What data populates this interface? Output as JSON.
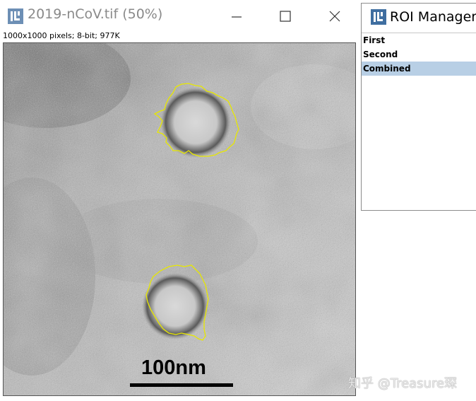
{
  "image_window": {
    "title": "2019-nCoV.tif (50%)",
    "info": "1000x1000 pixels; 8-bit; 977K",
    "icons": {
      "app": "imagej-icon",
      "minimize": "minimize-icon",
      "maximize": "maximize-icon",
      "close": "close-icon"
    },
    "scale_bar_label": "100nm",
    "roi_outline_color": "#e8e800"
  },
  "roi_manager": {
    "title": "ROI Manager",
    "items": [
      {
        "label": "First",
        "selected": false
      },
      {
        "label": "Second",
        "selected": false
      },
      {
        "label": "Combined",
        "selected": true
      }
    ],
    "selection_color": "#b8cfe5"
  },
  "watermark": "知乎 @Treasure琛"
}
